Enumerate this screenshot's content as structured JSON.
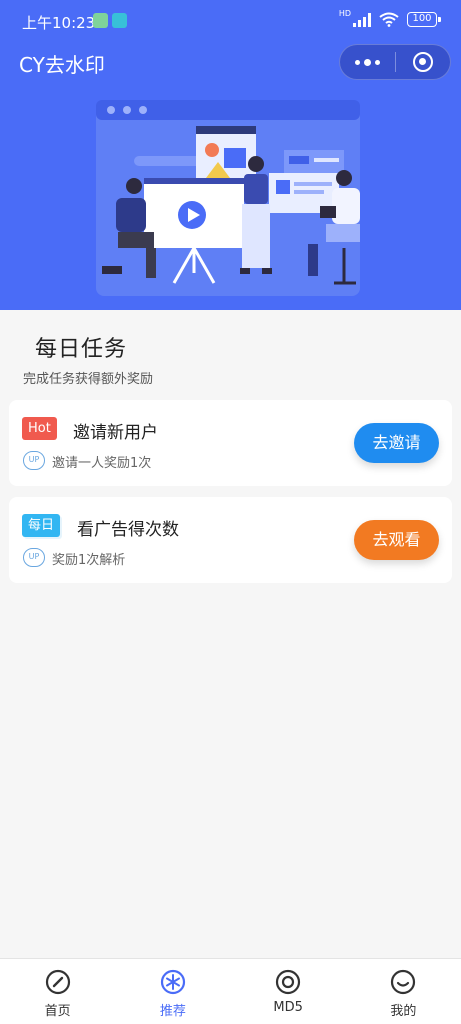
{
  "status_bar": {
    "time": "上午10:23",
    "battery": "100",
    "network": "HD"
  },
  "header": {
    "title": "CY去水印"
  },
  "daily_task": {
    "title": "每日任务",
    "subtitle": "完成任务获得额外奖励",
    "items": [
      {
        "tag": "Hot",
        "title": "邀请新用户",
        "badge": "UP",
        "desc": "邀请一人奖励1次",
        "button": "去邀请"
      },
      {
        "tag": "每日",
        "title": "看广告得次数",
        "badge": "UP",
        "desc": "奖励1次解析",
        "button": "去观看"
      }
    ]
  },
  "tabbar": {
    "items": [
      {
        "label": "首页",
        "icon": "compass-icon",
        "active": false
      },
      {
        "label": "推荐",
        "icon": "snowflake-icon",
        "active": true
      },
      {
        "label": "MD5",
        "icon": "target-icon",
        "active": false
      },
      {
        "label": "我的",
        "icon": "smile-icon",
        "active": false
      }
    ]
  },
  "colors": {
    "banner": "#4a6cf7",
    "hot_tag": "#f05a4e",
    "daily_tag": "#32b6f2",
    "invite_button": "#1f8cf0",
    "watch_button": "#f27a22",
    "active_tab": "#4a6cf7"
  }
}
